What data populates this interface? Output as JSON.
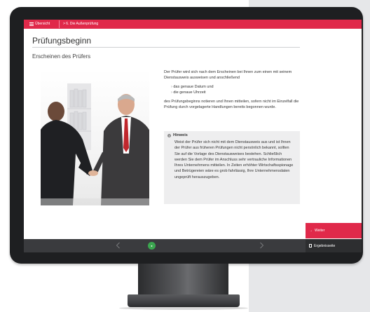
{
  "nav": {
    "home_label": "Übersicht",
    "breadcrumb": "> 6. Die Außenprüfung"
  },
  "page": {
    "title": "Prüfungsbeginn",
    "section_title": "Erscheinen des Prüfers"
  },
  "content": {
    "intro": "Der Prüfer wird sich nach dem Erscheinen bei Ihnen zum einen mit seinem Dienstausweis ausweisen und anschließend",
    "bullets": [
      "das genaue Datum und",
      "die genaue Uhrzeit"
    ],
    "outro": "des Prüfungsbeginns notieren und Ihnen mitteilen, sofern nicht im Einzelfall die Prüfung durch vorgelagerte Handlungen bereits begonnen wurde."
  },
  "hint": {
    "title": "Hinweis",
    "text": "Weist der Prüfer sich nicht mit dem Dienstausweis aus und ist Ihnen der Prüfer aus früheren Prüfungen nicht persönlich bekannt, sollten Sie auf die Vorlage des Dienstausweises bestehen. Schließlich werden Sie dem Prüfer im Anschluss sehr vertrauliche Informationen Ihres Unternehmens mitteilen. In Zeiten erhöhter Wirtschaftsspionage und Betrügereien wäre es grob fahrlässig, Ihre Unternehmensdaten ungeprüft herauszugeben."
  },
  "actions": {
    "next_label": "Weiter",
    "results_label": "Ergebnisseite"
  },
  "colors": {
    "accent": "#e0294a",
    "footer": "#3a3b3e",
    "progress": "#3ba64f"
  }
}
